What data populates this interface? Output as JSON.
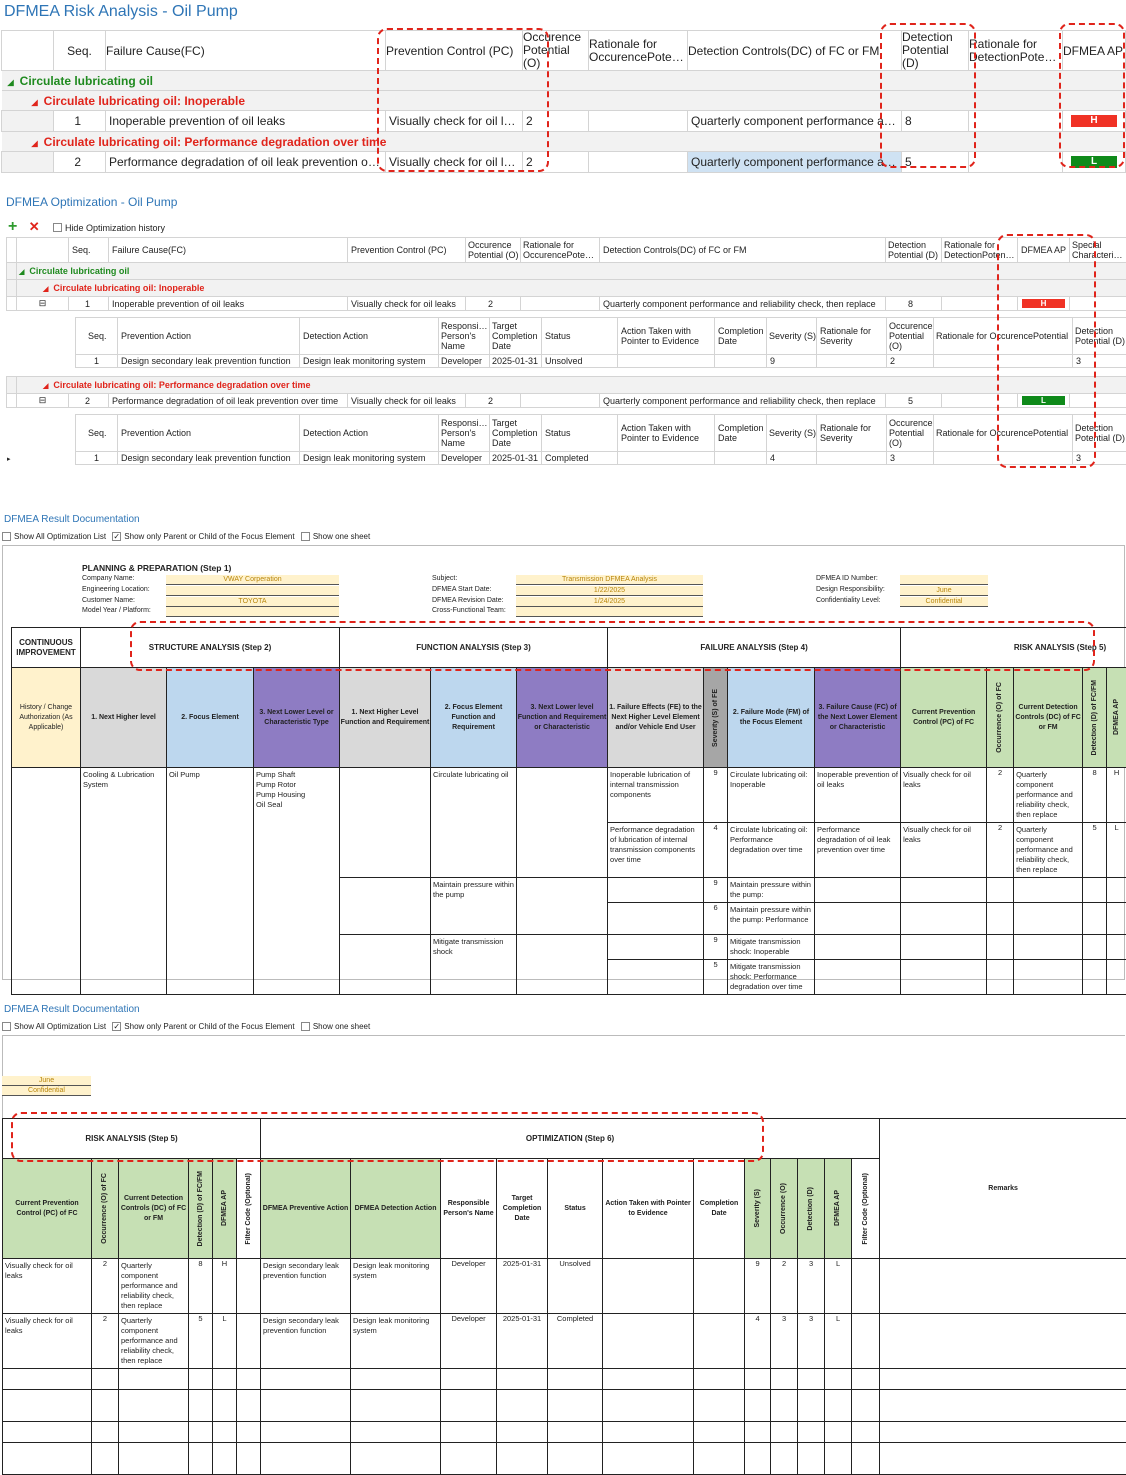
{
  "risk": {
    "title": "DFMEA Risk Analysis - Oil Pump",
    "headers": [
      "Seq.",
      "Failure Cause(FC)",
      "Prevention Control (PC)",
      "Occurence Potential (O)",
      "Rationale for OccurencePotential",
      "Detection Controls(DC) of FC or FM",
      "Detection Potential (D)",
      "Rationale for DetectionPotential",
      "DFMEA AP"
    ],
    "group": "Circulate lubricating oil",
    "sub1": "Circulate lubricating oil: Inoperable",
    "sub2": "Circulate lubricating oil: Performance degradation over time",
    "rows": [
      {
        "seq": "1",
        "fc": "Inoperable prevention of oil leaks",
        "pc": "Visually check for oil leaks",
        "o": "2",
        "dc": "Quarterly component performance and re...",
        "d": "8",
        "ap": "H"
      },
      {
        "seq": "2",
        "fc": "Performance degradation of oil leak prevention over time",
        "pc": "Visually check for oil leaks",
        "o": "2",
        "dc": "Quarterly component performance and re...",
        "d": "5",
        "ap": "L"
      }
    ]
  },
  "opt": {
    "title": "DFMEA Optimization - Oil Pump",
    "toolbar": {
      "add": "+",
      "remove": "✕",
      "hide_history": "Hide Optimization history"
    },
    "headers": [
      "Seq.",
      "Failure Cause(FC)",
      "Prevention Control (PC)",
      "Occurence Potential (O)",
      "Rationale for OccurencePotential",
      "Detection Controls(DC) of FC or FM",
      "Detection Potential (D)",
      "Rationale for DetectionPotential",
      "DFMEA AP",
      "Special Characteristic"
    ],
    "group": "Circulate lubricating oil",
    "sub1": "Circulate lubricating oil: Inoperable",
    "sub2": "Circulate lubricating oil: Performance degradation over time",
    "rows": [
      {
        "seq": "1",
        "fc": "Inoperable prevention of oil leaks",
        "pc": "Visually check for oil leaks",
        "o": "2",
        "dc": "Quarterly component performance and reliability check, then replace",
        "d": "8",
        "ap": "H"
      },
      {
        "seq": "2",
        "fc": "Performance degradation of oil leak prevention over time",
        "pc": "Visually check for oil leaks",
        "o": "2",
        "dc": "Quarterly component performance and reliability check, then replace",
        "d": "5",
        "ap": "L"
      }
    ],
    "sub_headers": [
      "Seq.",
      "Prevention Action",
      "Detection Action",
      "Responsible Person's Name",
      "Target Completion Date",
      "Status",
      "Action Taken with Pointer to Evidence",
      "Completion Date",
      "Severity (S)",
      "Rationale for Severity",
      "Occurence Potential (O)",
      "Rationale for OccurencePotential",
      "Detection Potential (D)"
    ],
    "actions": [
      {
        "seq": "1",
        "pa": "Design secondary leak prevention function",
        "da": "Design leak monitoring system",
        "resp": "Developer",
        "date": "2025-01-31",
        "status": "Unsolved",
        "sev": "9",
        "occ": "2",
        "det": "3"
      },
      {
        "seq": "1",
        "pa": "Design secondary leak prevention function",
        "da": "Design leak monitoring system",
        "resp": "Developer",
        "date": "2025-01-31",
        "status": "Completed",
        "sev": "4",
        "occ": "3",
        "det": "3"
      }
    ]
  },
  "doc1": {
    "title": "DFMEA Result Documentation",
    "options": [
      "Show All Optimization List",
      "Show only Parent or Child of the Focus Element",
      "Show one sheet"
    ],
    "plan_title": "PLANNING & PREPARATION (Step 1)",
    "plan": {
      "company_label": "Company Name:",
      "company": "VWAY Corperation",
      "eng_label": "Engineering Location:",
      "eng": "",
      "customer_label": "Customer Name:",
      "customer": "TOYOTA",
      "model_label": "Model Year / Platform:",
      "model": "",
      "subject_label": "Subject:",
      "subject": "Transmission DFMEA Analysis",
      "start_label": "DFMEA Start Date:",
      "start": "1/22/2025",
      "rev_label": "DFMEA Revision Date:",
      "rev": "1/24/2025",
      "team_label": "Cross-Functional Team:",
      "team": "",
      "id_label": "DFMEA ID Number:",
      "id": "",
      "resp_label": "Design Responsibility:",
      "resp": "June",
      "conf_label": "Confidentiality Level:",
      "conf": "Confidential"
    },
    "sections": [
      "CONTINUOUS IMPROVEMENT",
      "STRUCTURE ANALYSIS (Step 2)",
      "FUNCTION ANALYSIS (Step 3)",
      "FAILURE ANALYSIS (Step 4)",
      "RISK ANALYSIS (Step 5)"
    ],
    "col_headers": [
      "History / Change Authorization (As Applicable)",
      "1. Next Higher level",
      "2. Focus Element",
      "3. Next Lower Level or Characteristic Type",
      "1. Next Higher Level Function and Requirement",
      "2. Focus Element Function and Requirement",
      "3. Next Lower level Function and Requirement or Characteristic",
      "1. Failure Effects (FE) to the Next Higher Level Element and/or Vehicle End User",
      "Severity (S) of FE",
      "2. Failure Mode (FM) of the Focus Element",
      "3. Failure Cause (FC) of the Next Lower Element or Characteristic",
      "Current Prevention Control (PC) of FC",
      "Occurrence (O) of FC",
      "Current Detection Controls (DC) of FC or FM",
      "Detection (D) of FC/FM",
      "DFMEA AP"
    ],
    "structure": {
      "higher": "Cooling & Lubrication System",
      "focus": "Oil Pump",
      "lower": "Pump Shaft\nPump Rotor\nPump Housing\nOil Seal"
    },
    "functions": [
      "Circulate lubricating oil",
      "Maintain pressure within the pump",
      "Mitigate transmission shock"
    ],
    "rows": [
      {
        "fe": "Inoperable lubrication of internal transmission components",
        "s": "9",
        "fm": "Circulate lubricating oil: Inoperable",
        "fc": "Inoperable prevention of oil leaks",
        "pc": "Visually check for oil leaks",
        "o": "2",
        "dc": "Quarterly component performance and reliability check, then replace",
        "d": "8",
        "ap": "H"
      },
      {
        "fe": "Performance degradation of lubrication of internal transmission components over time",
        "s": "4",
        "fm": "Circulate lubricating oil: Performance degradation over time",
        "fc": "Performance degradation of oil leak prevention over time",
        "pc": "Visually check for oil leaks",
        "o": "2",
        "dc": "Quarterly component performance and reliability check, then replace",
        "d": "5",
        "ap": "L"
      },
      {
        "fe": "",
        "s": "9",
        "fm": "Maintain pressure within the pump:",
        "fc": "",
        "pc": "",
        "o": "",
        "dc": "",
        "d": "",
        "ap": ""
      },
      {
        "fe": "",
        "s": "6",
        "fm": "Maintain pressure within the pump: Performance",
        "fc": "",
        "pc": "",
        "o": "",
        "dc": "",
        "d": "",
        "ap": ""
      },
      {
        "fe": "",
        "s": "9",
        "fm": "Mitigate transmission shock: Inoperable",
        "fc": "",
        "pc": "",
        "o": "",
        "dc": "",
        "d": "",
        "ap": ""
      },
      {
        "fe": "",
        "s": "5",
        "fm": "Mitigate transmission shock: Performance degradation over time",
        "fc": "",
        "pc": "",
        "o": "",
        "dc": "",
        "d": "",
        "ap": ""
      }
    ]
  },
  "doc2": {
    "title": "DFMEA Result Documentation",
    "options": [
      "Show All Optimization List",
      "Show only Parent or Child of the Focus Element",
      "Show one sheet"
    ],
    "june": "June",
    "conf": "Confidential",
    "sections": [
      "RISK ANALYSIS (Step 5)",
      "OPTIMIZATION (Step 6)"
    ],
    "col_headers": [
      "Current Prevention Control (PC) of FC",
      "Occurrence (O) of FC",
      "Current Detection Controls (DC) of FC or FM",
      "Detection (D) of FC/FM",
      "DFMEA AP",
      "Filter Code (Optional)",
      "DFMEA Preventive Action",
      "DFMEA Detection Action",
      "Responsible Person's Name",
      "Target Completion Date",
      "Status",
      "Action Taken with Pointer to Evidence",
      "Completion Date",
      "Severity (S)",
      "Occurrence (O)",
      "Detection (D)",
      "DFMEA AP",
      "Filter Code (Optional)",
      "Remarks"
    ],
    "rows": [
      {
        "pc": "Visually check for oil leaks",
        "o": "2",
        "dc": "Quarterly component performance and reliability check, then replace",
        "d": "8",
        "ap": "H",
        "pa": "Design secondary leak prevention function",
        "da": "Design leak monitoring system",
        "resp": "Developer",
        "date": "2025-01-31",
        "status": "Unsolved",
        "s2": "9",
        "o2": "2",
        "d2": "3",
        "ap2": "L"
      },
      {
        "pc": "Visually check for oil leaks",
        "o": "2",
        "dc": "Quarterly component performance and reliability check, then replace",
        "d": "5",
        "ap": "L",
        "pa": "Design secondary leak prevention function",
        "da": "Design leak monitoring system",
        "resp": "Developer",
        "date": "2025-01-31",
        "status": "Completed",
        "s2": "4",
        "o2": "3",
        "d2": "3",
        "ap2": "L"
      }
    ]
  },
  "colors": {
    "title_blue": "#2e75b6",
    "ap_high": "#f03225",
    "ap_low": "#0f8a1a",
    "highlight_dash": "#e0241b"
  }
}
